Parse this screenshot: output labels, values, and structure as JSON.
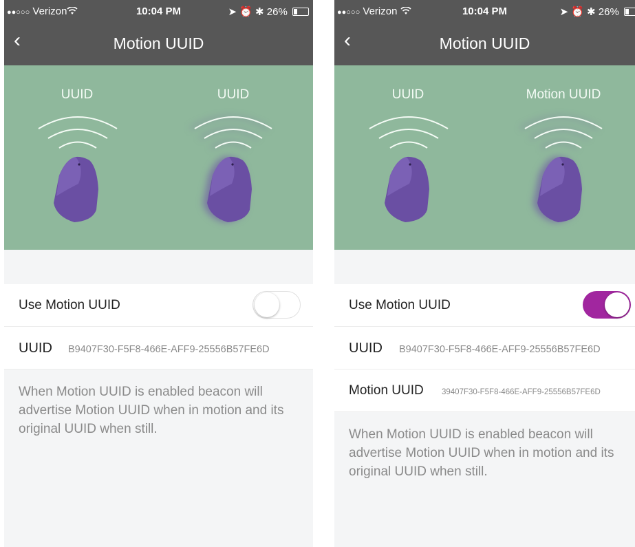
{
  "status_bar": {
    "carrier": "Verizon",
    "time": "10:04 PM",
    "battery": "26%",
    "battery_level": 0.26
  },
  "left_screen": {
    "title": "Motion UUID",
    "beacon_labels": [
      "UUID",
      "UUID"
    ],
    "toggle_label": "Use Motion UUID",
    "toggle_on": false,
    "uuid_label": "UUID",
    "uuid_value": "B9407F30-F5F8-466E-AFF9-25556B57FE6D",
    "description": "When Motion UUID is enabled beacon will advertise Motion UUID when in motion and its original UUID when still."
  },
  "right_screen": {
    "title": "Motion UUID",
    "beacon_labels": [
      "UUID",
      "Motion UUID"
    ],
    "toggle_label": "Use Motion UUID",
    "toggle_on": true,
    "uuid_label": "UUID",
    "uuid_value": "B9407F30-F5F8-466E-AFF9-25556B57FE6D",
    "motion_uuid_label": "Motion UUID",
    "motion_uuid_value": "39407F30-F5F8-466E-AFF9-25556B57FE6D",
    "description": "When Motion UUID is enabled beacon will advertise Motion UUID when in motion and its original UUID when still."
  },
  "colors": {
    "header": "#575757",
    "hero": "#8fb89c",
    "beacon": "#6a4fa3",
    "toggle_on": "#a1269f"
  },
  "icons": [
    "wifi-icon",
    "location-icon",
    "alarm-icon",
    "bluetooth-icon",
    "battery-icon",
    "back-chevron-icon"
  ]
}
